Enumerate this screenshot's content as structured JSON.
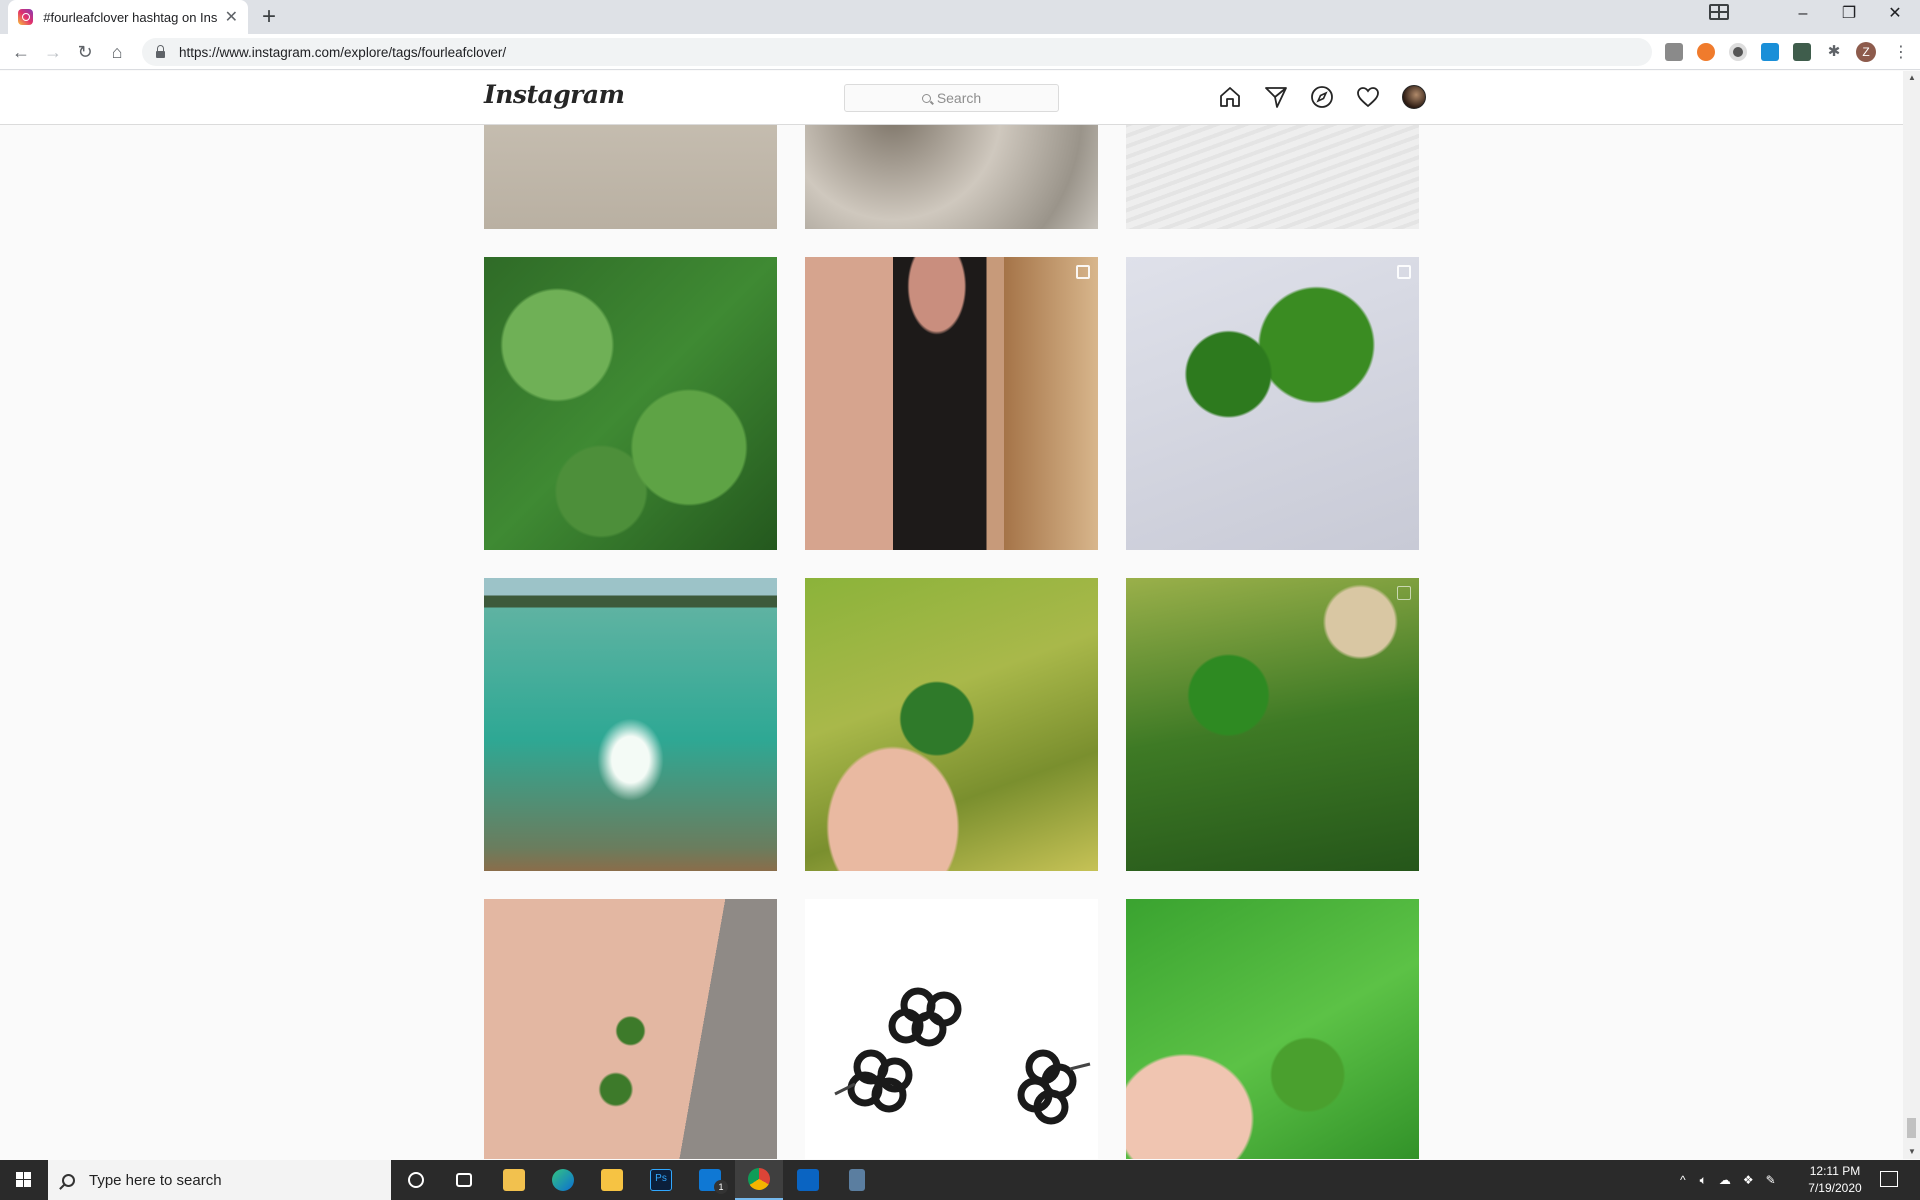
{
  "browser": {
    "tab_title": "#fourleafclover hashtag on Insta",
    "url": "https://www.instagram.com/explore/tags/fourleafclover/",
    "profile_initial": "Z",
    "icons": [
      "back-icon",
      "forward-icon",
      "reload-icon",
      "home-icon",
      "lock-icon",
      "extensions-icon",
      "menu-icon"
    ]
  },
  "instagram": {
    "logo_text": "Instagram",
    "search_placeholder": "Search",
    "nav_icons": [
      "home-icon",
      "direct-icon",
      "explore-icon",
      "activity-heart-icon",
      "profile-avatar"
    ]
  },
  "grid": {
    "tiles": [
      {
        "subject": "beige sand",
        "badge": false
      },
      {
        "subject": "granite stone with clover stem",
        "badge": false
      },
      {
        "subject": "white textured surface",
        "badge": false
      },
      {
        "subject": "clover patch",
        "badge": false
      },
      {
        "subject": "woman with necklace",
        "badge": true
      },
      {
        "subject": "two four leaf clovers",
        "badge": true
      },
      {
        "subject": "person splashing in lake",
        "badge": false
      },
      {
        "subject": "hand holding clover in meadow",
        "badge": false
      },
      {
        "subject": "clovers in grass",
        "badge": true
      },
      {
        "subject": "clovers on leg",
        "badge": false
      },
      {
        "subject": "clover shaped earrings",
        "badge": false
      },
      {
        "subject": "hand holding clover on lawn",
        "badge": false
      }
    ]
  },
  "taskbar": {
    "search_placeholder": "Type here to search",
    "time": "12:11 PM",
    "date": "7/19/2020",
    "mail_badge": "1"
  }
}
